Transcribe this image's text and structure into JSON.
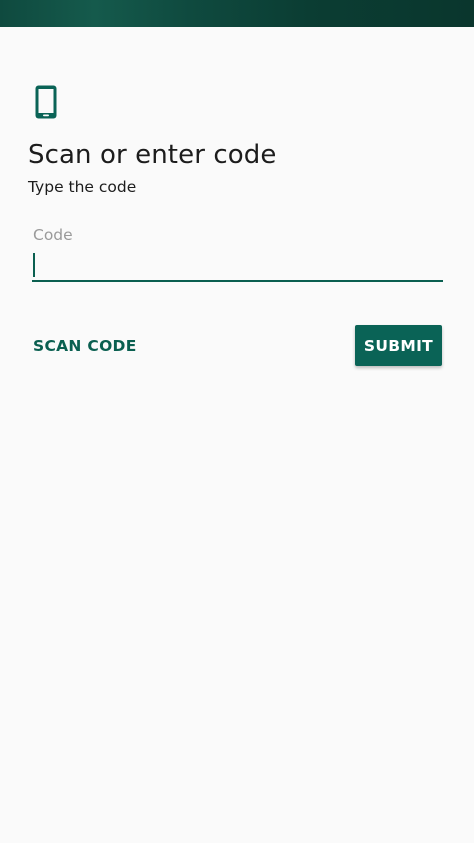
{
  "screen": {
    "title": "Scan or enter code",
    "subtitle": "Type the code",
    "icon": "smartphone-icon"
  },
  "code_field": {
    "label": "Code",
    "value": ""
  },
  "actions": {
    "scan_label": "SCAN CODE",
    "submit_label": "SUBMIT"
  },
  "colors": {
    "accent": "#0a6356",
    "status_bar": "#0f4a3f",
    "background": "#fafafa",
    "text": "#1c1c1c",
    "hint": "#9a9a9a"
  }
}
